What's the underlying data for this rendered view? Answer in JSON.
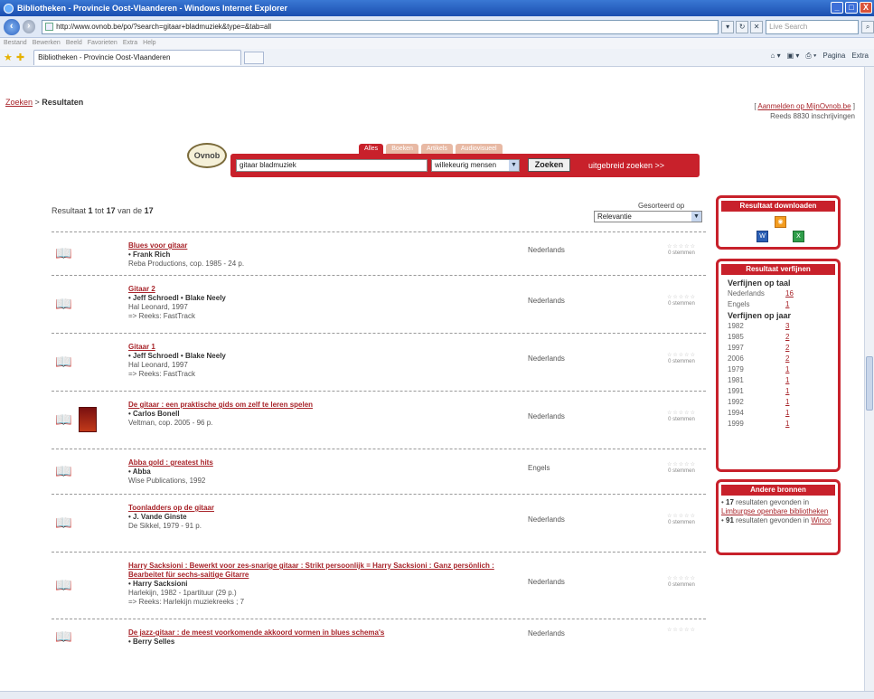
{
  "window": {
    "title": "Bibliotheken - Provincie Oost-Vlaanderen - Windows Internet Explorer",
    "buttons": [
      "_",
      "□",
      "X"
    ]
  },
  "addressbar": {
    "url": "http://www.ovnob.be/po/?search=gitaar+bladmuziek&type=&tab=all",
    "search_placeholder": "Live Search"
  },
  "menubar": [
    "Bestand",
    "Bewerken",
    "Beeld",
    "Favorieten",
    "Extra",
    "Help"
  ],
  "tabbar": {
    "tab_label": "Bibliotheken - Provincie Oost-Vlaanderen",
    "commands": [
      "Pagina",
      "Extra"
    ]
  },
  "page": {
    "breadcrumb_link": "Zoeken",
    "breadcrumb_sep": " > ",
    "breadcrumb_current": "Resultaten",
    "login_link": "Aanmelden op MijnOvnob.be",
    "login_open": "[ ",
    "login_close": " ]",
    "registrations": "Reeds 8830 inschrijvingen",
    "logo_text": "Ovnob"
  },
  "search": {
    "tabs": [
      "Alles",
      "Boeken",
      "Artikels",
      "Audiovisueel"
    ],
    "query": "gitaar bladmuziek",
    "mode": "willekeurig mensen",
    "button": "Zoeken",
    "advanced": "uitgebreid zoeken >>"
  },
  "results_header": {
    "count_prefix": "Resultaat ",
    "count_from": "1",
    "count_mid1": " tot ",
    "count_to": "17",
    "count_mid2": " van de ",
    "count_total": "17",
    "sort_label": "Gesorteerd op",
    "sort_value": "Relevantie"
  },
  "results": [
    {
      "title": "Blues voor gitaar",
      "author": "• Frank Rich",
      "pub": "Reba Productions, cop. 1985 - 24 p.",
      "series": "",
      "lang": "Nederlands",
      "rating": "0 stemmen",
      "cover": false
    },
    {
      "title": "Gitaar 2",
      "author": "• Jeff Schroedl • Blake Neely",
      "pub": "Hal Leonard, 1997",
      "series": "=> Reeks: FastTrack",
      "lang": "Nederlands",
      "rating": "0 stemmen",
      "cover": false
    },
    {
      "title": "Gitaar 1",
      "author": "• Jeff Schroedl • Blake Neely",
      "pub": "Hal Leonard, 1997",
      "series": "=> Reeks: FastTrack",
      "lang": "Nederlands",
      "rating": "0 stemmen",
      "cover": false
    },
    {
      "title": "De gitaar : een praktische gids om zelf te leren spelen",
      "author": "• Carlos Bonell",
      "pub": "Veltman, cop. 2005 - 96 p.",
      "series": "",
      "lang": "Nederlands",
      "rating": "0 stemmen",
      "cover": true
    },
    {
      "title": "Abba gold : greatest hits",
      "author": "• Abba",
      "pub": "Wise Publications, 1992",
      "series": "",
      "lang": "Engels",
      "rating": "0 stemmen",
      "cover": false
    },
    {
      "title": "Toonladders op de gitaar",
      "author": "• J. Vande Ginste",
      "pub": "De Sikkel, 1979 - 91 p.",
      "series": "",
      "lang": "Nederlands",
      "rating": "0 stemmen",
      "cover": false
    },
    {
      "title": "Harry Sacksioni : Bewerkt voor zes-snarige gitaar : Strikt persoonlijk = Harry Sacksioni : Ganz persönlich : Bearbeitet für sechs-saitige Gitarre",
      "author": "• Harry Sacksioni",
      "pub": "Harlekijn, 1982 - 1partituur (29 p.)",
      "series": "=> Reeks: Harlekijn muziekreeks ; 7",
      "lang": "Nederlands",
      "rating": "0 stemmen",
      "cover": false
    },
    {
      "title": "De jazz-gitaar : de meest voorkomende akkoord vormen in blues schema's",
      "author": "• Berry Selles",
      "pub": "",
      "series": "",
      "lang": "Nederlands",
      "rating": "",
      "cover": false
    }
  ],
  "download": {
    "head": "Resultaat downloaden",
    "icons": [
      "rss-icon",
      "word-icon",
      "excel-icon"
    ]
  },
  "refine": {
    "head": "Resultaat verfijnen",
    "lang_group": "Verfijnen op taal",
    "langs": [
      {
        "label": "Nederlands",
        "count": "16"
      },
      {
        "label": "Engels",
        "count": "1"
      }
    ],
    "year_group": "Verfijnen op jaar",
    "years": [
      {
        "label": "1982",
        "count": "3"
      },
      {
        "label": "1985",
        "count": "2"
      },
      {
        "label": "1997",
        "count": "2"
      },
      {
        "label": "2006",
        "count": "2"
      },
      {
        "label": "1979",
        "count": "1"
      },
      {
        "label": "1981",
        "count": "1"
      },
      {
        "label": "1991",
        "count": "1"
      },
      {
        "label": "1992",
        "count": "1"
      },
      {
        "label": "1994",
        "count": "1"
      },
      {
        "label": "1999",
        "count": "1"
      }
    ]
  },
  "other": {
    "head": "Andere bronnen",
    "line1_count": "17",
    "line1_text": " resultaten gevonden in ",
    "line1_link": "Limburgse openbare bibliotheken",
    "line2_count": "91",
    "line2_text": " resultaten gevonden in ",
    "line2_link": "Winco"
  },
  "colors": {
    "accent": "#c8212b",
    "link": "#a8242a",
    "titlebar": "#1b4fb0"
  }
}
